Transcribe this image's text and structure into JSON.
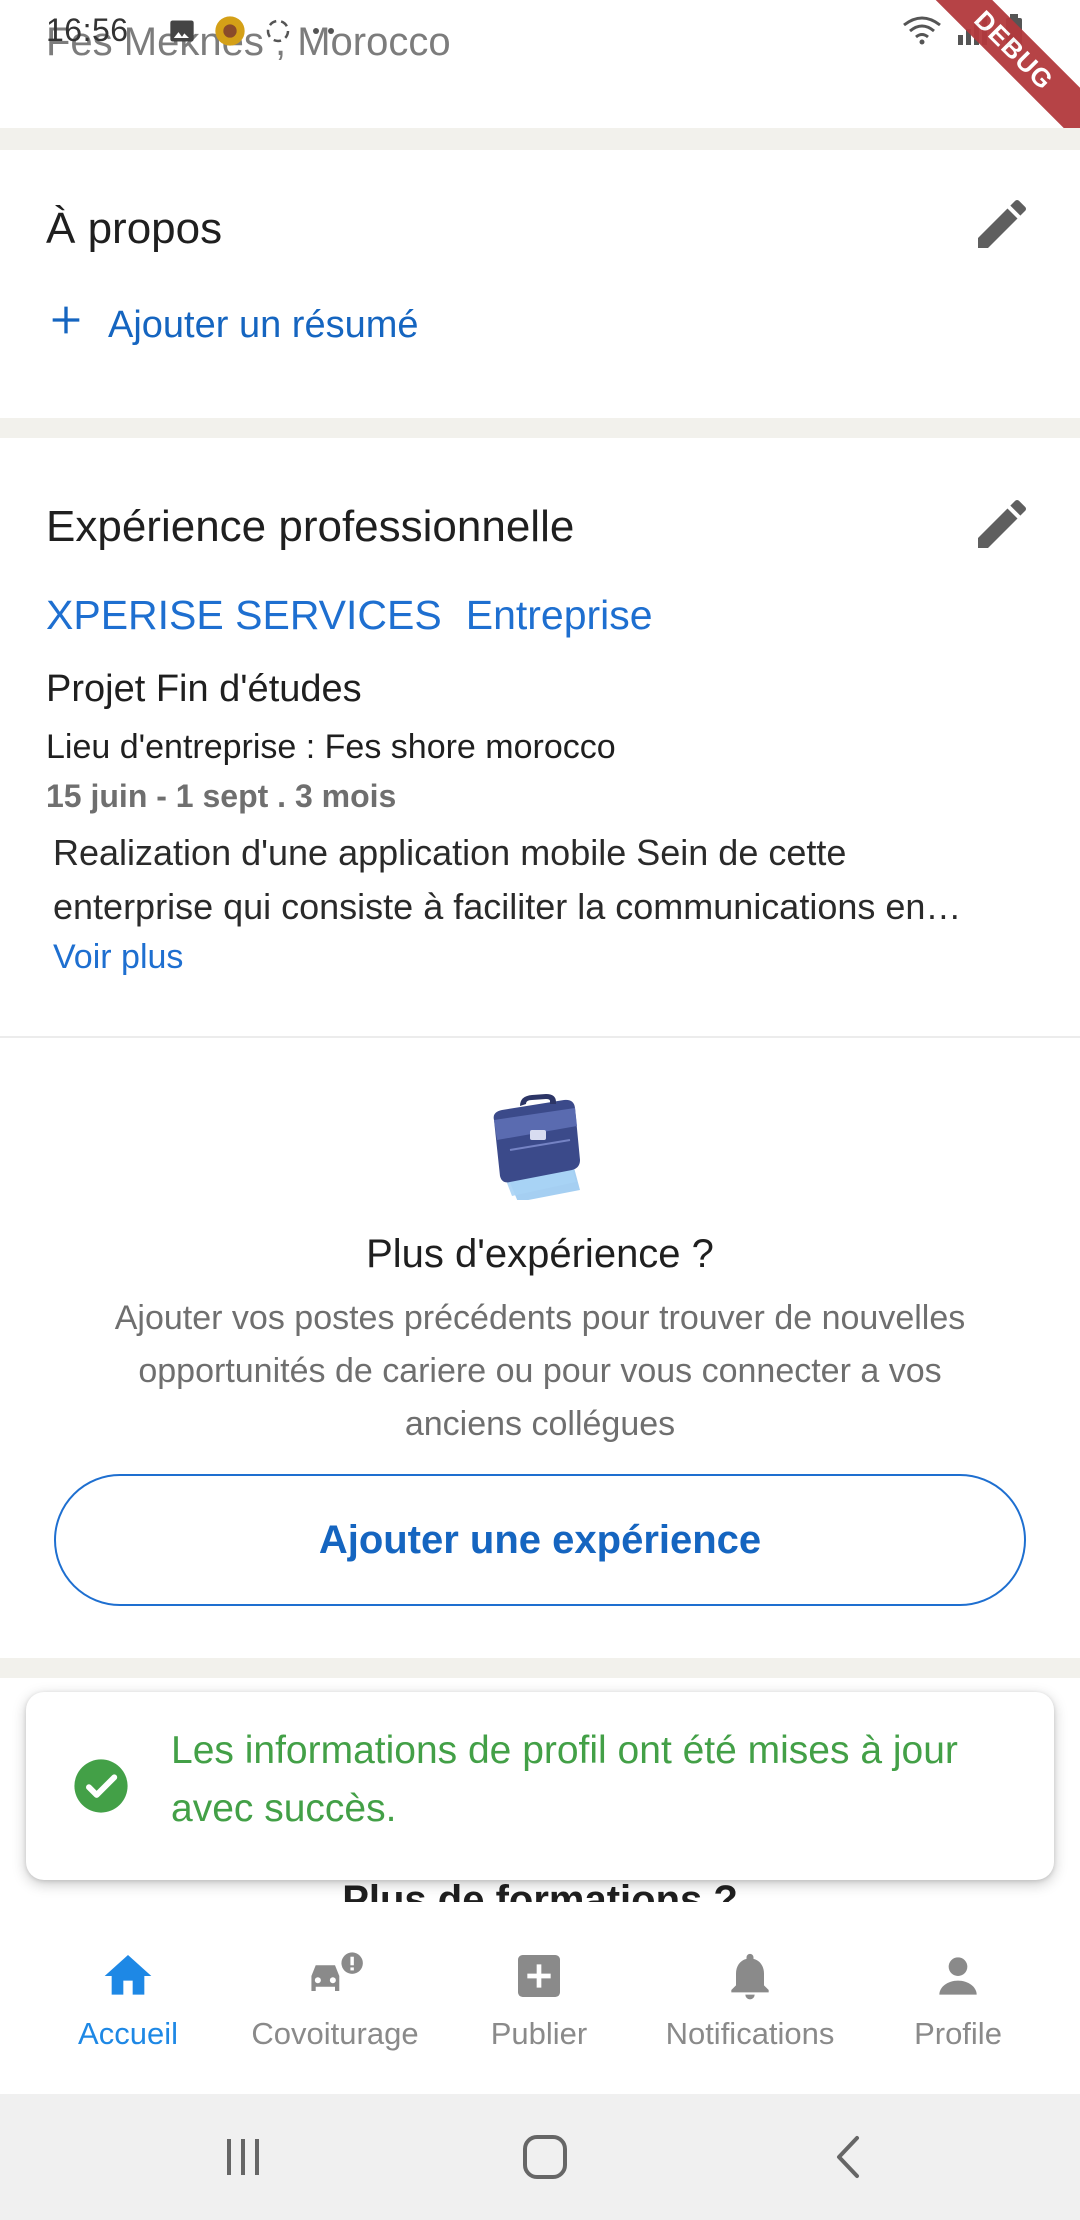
{
  "status_bar": {
    "time": "16:56",
    "debug_label": "DEBUG"
  },
  "header": {
    "location": "Fes Meknes , Morocco"
  },
  "about": {
    "title": "À propos",
    "add_summary_label": "Ajouter un résumé"
  },
  "experience": {
    "title": "Expérience professionnelle",
    "company": "XPERISE SERVICES",
    "company_type": "Entreprise",
    "job_title": "Projet Fin d'études",
    "location": "Lieu d'entreprise : Fes shore morocco",
    "dates": "15 juin - 1 sept . 3 mois",
    "description_line1": "Realization d'une application mobile Sein de cette",
    "description_line2": "enterprise qui consiste à faciliter la communications en…",
    "see_more": "Voir plus"
  },
  "more_experience": {
    "title": "Plus d'expérience ?",
    "text": "Ajouter vos postes précédents pour trouver de nouvelles opportunités de cariere ou pour vous connecter a vos anciens collégues",
    "button_label": "Ajouter une expérience"
  },
  "more_education": {
    "title": "Plus de formations ?"
  },
  "snackbar": {
    "message": "Les informations de profil ont été mises à jour avec succès."
  },
  "bottom_nav": {
    "items": [
      {
        "label": "Accueil",
        "icon": "home-icon",
        "active": true
      },
      {
        "label": "Covoiturage",
        "icon": "car-alert-icon",
        "active": false
      },
      {
        "label": "Publier",
        "icon": "add-box-icon",
        "active": false
      },
      {
        "label": "Notifications",
        "icon": "bell-icon",
        "active": false
      },
      {
        "label": "Profile",
        "icon": "person-icon",
        "active": false
      }
    ]
  },
  "colors": {
    "primary": "#1e6fd0",
    "active_nav": "#1e88e5",
    "success": "#43a047",
    "section_gap": "#f2f1ec",
    "debug_ribbon": "#b3393d"
  }
}
